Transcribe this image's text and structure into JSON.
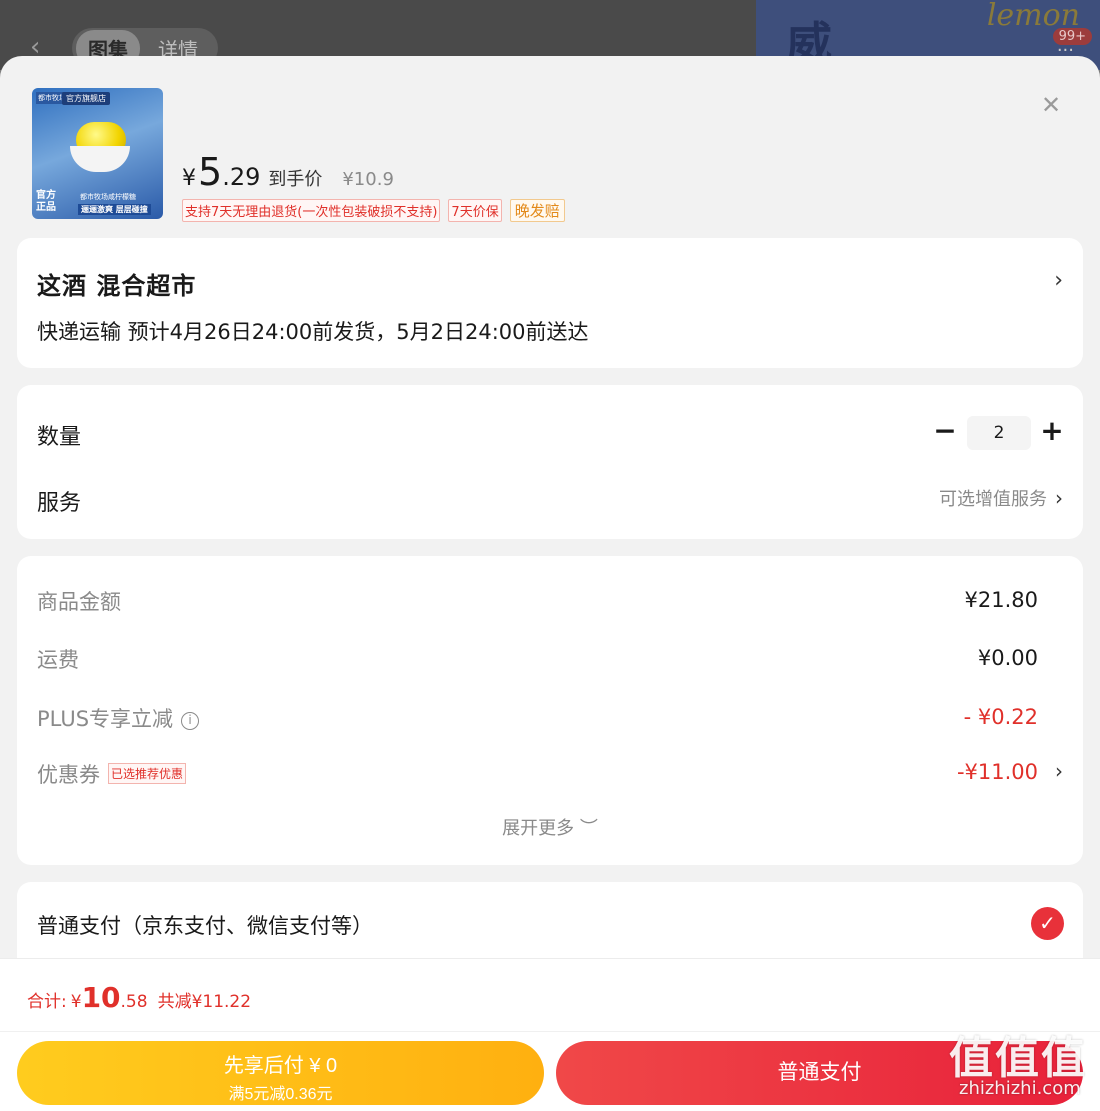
{
  "background": {
    "back_icon": "chevron-left-icon",
    "tabs": [
      "图集",
      "详情"
    ],
    "banner_text": "威",
    "banner_script": "lemon",
    "badge": "99+"
  },
  "product": {
    "image": {
      "brand": "都市牧场",
      "store": "官方旗舰店",
      "corner_tag": "官方正品",
      "desc": "都市牧场咸柠檬糖",
      "slogan": "逦逦激爽 层层碰撞"
    },
    "currency": "¥",
    "price_int": "5",
    "price_dec": ".29",
    "price_label": "到手价",
    "original_price": "¥10.9",
    "tags": [
      "支持7天无理由退货(一次性包装破损不支持)",
      "7天价保"
    ],
    "extra_tag": "晚发赔",
    "close_icon": "close-icon"
  },
  "shop": {
    "name": "这酒  混合超市",
    "delivery": "快递运输 预计4月26日24:00前发货，5月2日24:00前送达"
  },
  "quantity": {
    "label": "数量",
    "value": "2",
    "minus": "−",
    "plus": "+"
  },
  "service": {
    "label": "服务",
    "value": "可选增值服务"
  },
  "summary": {
    "items": [
      {
        "label": "商品金额",
        "value": "¥21.80"
      },
      {
        "label": "运费",
        "value": "¥0.00"
      },
      {
        "label": "PLUS专享立减",
        "value": "- ¥0.22"
      },
      {
        "label": "优惠券",
        "value": "-¥11.00",
        "tag": "已选推荐优惠"
      }
    ],
    "expand": "展开更多 ︶"
  },
  "payment": {
    "label": "普通支付（京东支付、微信支付等）",
    "check_icon": "checkmark-icon"
  },
  "footer": {
    "total_label": "合计:",
    "total_yen": "¥",
    "total_int": "10",
    "total_dec": ".58",
    "total_save": "共减¥11.22",
    "later_main": "先享后付 ¥ 0",
    "later_sub": "满5元减0.36元",
    "pay_button": "普通支付"
  },
  "watermark": {
    "big": "值值值",
    "small": "zhizhizhi.com"
  },
  "colors": {
    "accent_red": "#e0302a",
    "pay_button": "#e8213a",
    "later_button": "#ffb010",
    "orange_tag": "#e38a1a"
  }
}
